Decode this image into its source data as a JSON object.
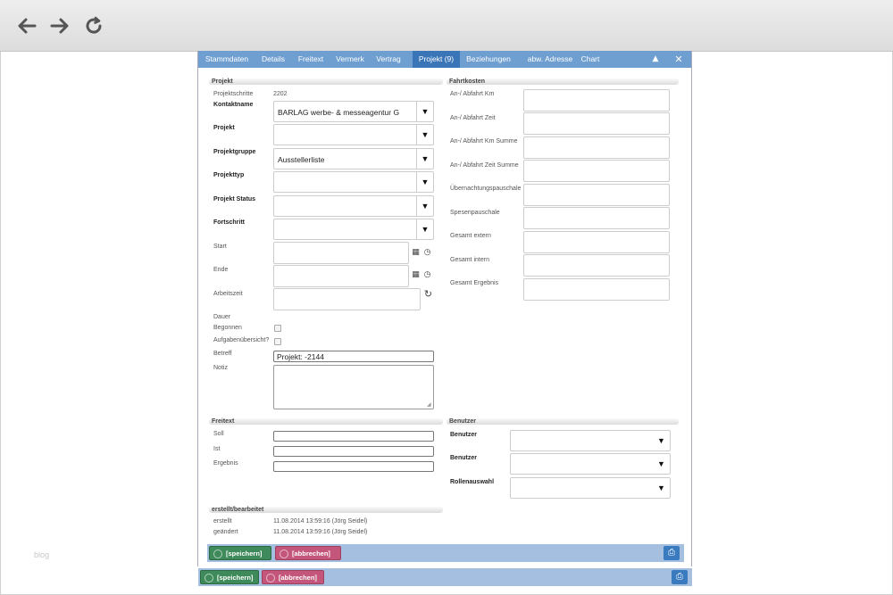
{
  "browser": {
    "icons": [
      "back-arrow-icon",
      "forward-arrow-icon",
      "reload-icon"
    ]
  },
  "watermark": "blog",
  "tabs": [
    {
      "label": "Stammdaten"
    },
    {
      "label": "Details"
    },
    {
      "label": "Freitext"
    },
    {
      "label": "Vermerk"
    },
    {
      "label": "Vertrag"
    },
    {
      "label": "Projekt (9)",
      "active": true
    },
    {
      "label": "Beziehungen"
    },
    {
      "label": "abw. Adresse"
    },
    {
      "label": "Chart"
    }
  ],
  "tab_controls": {
    "up": "▲",
    "close": "✕"
  },
  "projekt": {
    "title": "Projekt",
    "projektschritte_label": "Projektschritte",
    "projektschritte_value": "2202",
    "kontaktname_label": "Kontaktname",
    "kontaktname_value": "BARLAG werbe- & messeagentur G",
    "projekt_label": "Projekt",
    "projektgruppe_label": "Projektgruppe",
    "projektgruppe_value": "Ausstellerliste",
    "projekttyp_label": "Projekttyp",
    "projekt_status_label": "Projekt Status",
    "fortschritt_label": "Fortschritt",
    "start_label": "Start",
    "ende_label": "Ende",
    "arbeitszeit_label": "Arbeitszeit",
    "dauer_label": "Dauer",
    "begonnen_label": "Begonnen",
    "aufgabenuebersicht_label": "Aufgabenübersicht?",
    "betreff_label": "Betreff",
    "betreff_value": "Projekt:  -2144",
    "notiz_label": "Notiz"
  },
  "fahrtkosten": {
    "title": "Fahrtkosten",
    "fields": [
      "An-/ Abfahrt Km",
      "An-/ Abfahrt Zeit",
      "An-/ Abfahrt Km Summe",
      "An-/ Abfahrt Zeit Summe",
      "Übernachtungspauschale",
      "Spesenpauschale",
      "Gesamt extern",
      "Gesamt intern",
      "Gesamt Ergebnis"
    ]
  },
  "freitext": {
    "title": "Freitext",
    "soll_label": "Soll",
    "ist_label": "Ist",
    "ergebnis_label": "Ergebnis"
  },
  "benutzer": {
    "title": "Benutzer",
    "benutzer1_label": "Benutzer",
    "benutzer2_label": "Benutzer",
    "rollenauswahl_label": "Rollenauswahl"
  },
  "erstellt": {
    "title": "erstellt/bearbeitet",
    "erstellt_label": "erstellt",
    "erstellt_value": "11.08.2014 13:59:16 (Jörg Seidel)",
    "geaendert_label": "geändert",
    "geaendert_value": "11.08.2014 13:59:16 (Jörg Seidel)"
  },
  "buttons": {
    "save": "[speichern]",
    "cancel": "[abbrechen]"
  },
  "glyphs": {
    "arrow": "▼",
    "calendar": "▦",
    "clock": "◷",
    "refresh": "↻",
    "print": "⎙"
  }
}
